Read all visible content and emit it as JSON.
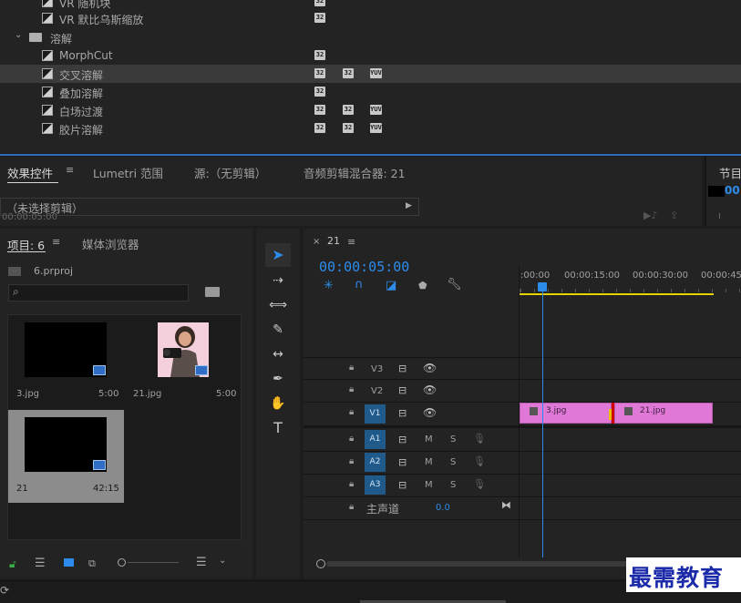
{
  "effects": {
    "rows": [
      {
        "label": "VR 随机块",
        "badges": [
          "32"
        ]
      },
      {
        "label": "VR 默比乌斯缩放",
        "badges": [
          "32"
        ]
      },
      {
        "label": "MorphCut",
        "badges": [
          "32"
        ]
      },
      {
        "label": "交叉溶解",
        "badges": [
          "32",
          "32",
          "YUV"
        ],
        "selected": true
      },
      {
        "label": "叠加溶解",
        "badges": [
          "32"
        ]
      },
      {
        "label": "白场过渡",
        "badges": [
          "32",
          "32",
          "YUV"
        ]
      },
      {
        "label": "胶片溶解",
        "badges": [
          "32",
          "32",
          "YUV"
        ]
      }
    ],
    "folder_label": "溶解"
  },
  "panel_tabs": {
    "effect_controls": "效果控件",
    "lumetri": "Lumetri 范围",
    "source": "源:（无剪辑）",
    "audio_mixer": "音频剪辑混合器: 21",
    "program": "节目"
  },
  "effect_controls": {
    "no_clip": "（未选择剪辑）",
    "timecode": "00:00:05:00"
  },
  "project": {
    "tab_label": "项目: 6",
    "media_browser": "媒体浏览器",
    "file_name": "6.prproj",
    "search_placeholder": "",
    "items": [
      {
        "name": "3.jpg",
        "duration": "5:00"
      },
      {
        "name": "21.jpg",
        "duration": "5:00"
      },
      {
        "name": "21",
        "duration": "42:15"
      }
    ]
  },
  "timeline": {
    "sequence_name": "21",
    "timecode": "00:00:05:00",
    "ruler": [
      ":00:00",
      "00:00:15:00",
      "00:00:30:00",
      "00:00:45"
    ],
    "tracks": {
      "video": [
        "V3",
        "V2",
        "V1"
      ],
      "audio": [
        "A1",
        "A2",
        "A3"
      ],
      "target_v": "V1",
      "mute": "M",
      "solo": "S",
      "master": "主声道",
      "master_value": "0.0"
    },
    "clips": [
      {
        "name": "3.jpg"
      },
      {
        "name": "21.jpg"
      }
    ]
  },
  "watermark": "最需教育",
  "colors": {
    "accent_blue": "#2d8ceb",
    "clip_pink": "#e078d8",
    "work_yellow": "#e6d200",
    "target_blue": "#1f5a8a"
  }
}
